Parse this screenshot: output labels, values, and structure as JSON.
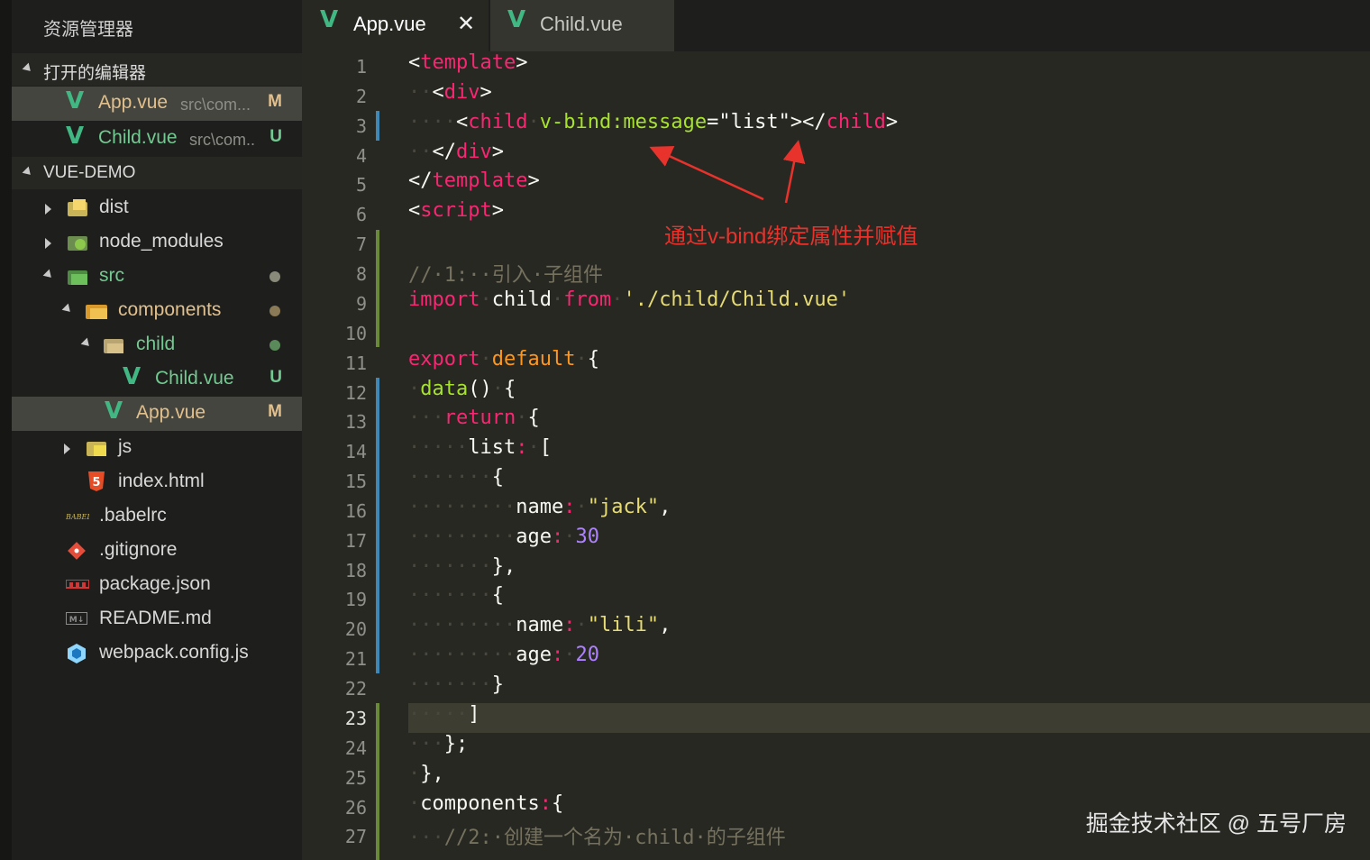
{
  "sidebar": {
    "title": "资源管理器",
    "open_editors": {
      "label": "打开的编辑器",
      "items": [
        {
          "name": "App.vue",
          "path": "src\\com...",
          "badge": "M"
        },
        {
          "name": "Child.vue",
          "path": "src\\com..",
          "badge": "U"
        }
      ]
    },
    "project": {
      "label": "VUE-DEMO",
      "items": [
        {
          "name": "dist"
        },
        {
          "name": "node_modules"
        },
        {
          "name": "src"
        },
        {
          "name": "components"
        },
        {
          "name": "child"
        },
        {
          "name": "Child.vue",
          "badge": "U"
        },
        {
          "name": "App.vue",
          "badge": "M"
        },
        {
          "name": "js"
        },
        {
          "name": "index.html"
        },
        {
          "name": ".babelrc"
        },
        {
          "name": ".gitignore"
        },
        {
          "name": "package.json"
        },
        {
          "name": "README.md"
        },
        {
          "name": "webpack.config.js"
        }
      ]
    }
  },
  "tabs": [
    {
      "label": "App.vue",
      "close": "✕"
    },
    {
      "label": "Child.vue"
    }
  ],
  "editor": {
    "line_numbers": [
      "1",
      "2",
      "3",
      "4",
      "5",
      "6",
      "7",
      "8",
      "9",
      "10",
      "11",
      "12",
      "13",
      "14",
      "15",
      "16",
      "17",
      "18",
      "19",
      "20",
      "21",
      "22",
      "23",
      "24",
      "25",
      "26",
      "27"
    ],
    "current_line": "23",
    "annotation": "通过v-bind绑定属性并赋值"
  },
  "watermark": "掘金技术社区 @ 五号厂房",
  "colors": {
    "modified": "#e2c08d",
    "untracked": "#73c991",
    "vue_green": "#41b883",
    "annotation_red": "#e8322c"
  }
}
